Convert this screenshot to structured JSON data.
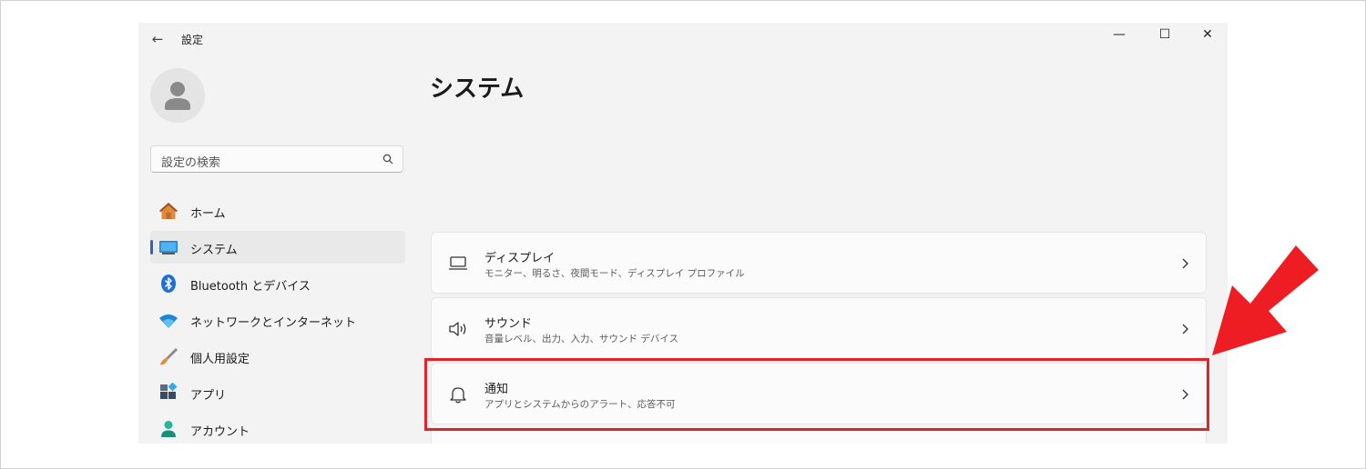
{
  "window": {
    "title": "設定",
    "controls": {
      "minimize": "—",
      "maximize": "☐",
      "close": "✕"
    }
  },
  "search": {
    "placeholder": "設定の検索"
  },
  "sidebar": {
    "items": [
      {
        "label": "ホーム",
        "icon": "home-icon",
        "selected": false
      },
      {
        "label": "システム",
        "icon": "system-icon",
        "selected": true
      },
      {
        "label": "Bluetooth とデバイス",
        "icon": "bluetooth-icon",
        "selected": false
      },
      {
        "label": "ネットワークとインターネット",
        "icon": "wifi-icon",
        "selected": false
      },
      {
        "label": "個人用設定",
        "icon": "brush-icon",
        "selected": false
      },
      {
        "label": "アプリ",
        "icon": "apps-icon",
        "selected": false
      },
      {
        "label": "アカウント",
        "icon": "account-icon",
        "selected": false
      }
    ]
  },
  "main": {
    "title": "システム",
    "cards": [
      {
        "title": "ディスプレイ",
        "subtitle": "モニター、明るさ、夜間モード、ディスプレイ プロファイル",
        "icon": "display-icon"
      },
      {
        "title": "サウンド",
        "subtitle": "音量レベル、出力、入力、サウンド デバイス",
        "icon": "speaker-icon"
      },
      {
        "title": "通知",
        "subtitle": "アプリとシステムからのアラート、応答不可",
        "icon": "bell-icon"
      }
    ]
  },
  "annotation": {
    "highlight_color": "#e0242a",
    "highlighted_card": "通知"
  },
  "colors": {
    "accent": "#2b62c8",
    "window_bg": "#f3f3f3",
    "card_bg": "#fbfbfb"
  }
}
